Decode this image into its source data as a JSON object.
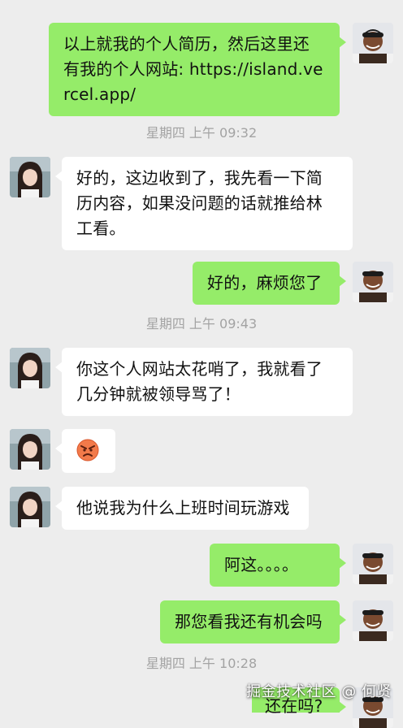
{
  "messages": [
    {
      "sender": "me",
      "text": "以上就我的个人简历，然后这里还有我的个人网站: https://island.vercel.app/"
    },
    {
      "timestamp": "星期四 上午 09:32"
    },
    {
      "sender": "them",
      "text": "好的，这边收到了，我先看一下简历内容，如果没问题的话就推给林工看。"
    },
    {
      "sender": "me",
      "text": "好的，麻烦您了"
    },
    {
      "timestamp": "星期四 上午 09:43"
    },
    {
      "sender": "them",
      "text": "你这个人网站太花哨了，我就看了几分钟就被领导骂了！"
    },
    {
      "sender": "them",
      "emoji": "angry-face-emoji"
    },
    {
      "sender": "them",
      "text": "他说我为什么上班时间玩游戏"
    },
    {
      "sender": "me",
      "text": "阿这。。。。"
    },
    {
      "sender": "me",
      "text": "那您看我还有机会吗"
    },
    {
      "timestamp": "星期四 上午 10:28"
    },
    {
      "sender": "me",
      "text": "还在吗?"
    }
  ],
  "watermark": "掘金技术社区 @ 何贤",
  "colors": {
    "background": "#ededed",
    "my_bubble": "#95ec69",
    "their_bubble": "#ffffff",
    "timestamp_text": "#a3a3a3"
  }
}
